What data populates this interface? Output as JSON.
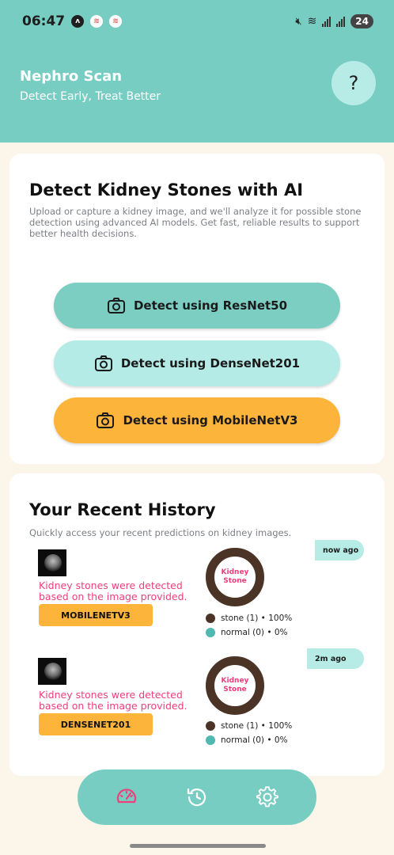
{
  "status_bar": {
    "time": "06:47",
    "battery": "24"
  },
  "header": {
    "title": "Nephro Scan",
    "subtitle": "Detect Early, Treat Better",
    "help_label": "?"
  },
  "detect_card": {
    "title": "Detect Kidney Stones with AI",
    "description": "Upload or capture a kidney image, and we'll analyze it for possible stone detection using advanced AI models. Get fast, reliable results to support better health decisions.",
    "buttons": [
      {
        "label": "Detect using ResNet50",
        "icon": "camera-icon",
        "color": "#7ccec3"
      },
      {
        "label": "Detect using DenseNet201",
        "icon": "camera-icon",
        "color": "#b5ebe6"
      },
      {
        "label": "Detect using MobileNetV3",
        "icon": "camera-icon",
        "color": "#fdb43a"
      }
    ]
  },
  "history_card": {
    "title": "Your Recent History",
    "description": "Quickly access your recent predictions on kidney images.",
    "items": [
      {
        "time": "now ago",
        "result": "Kidney stones were detected based on the image provided.",
        "model": "MOBILENETV3",
        "donut_label_line1": "Kidney",
        "donut_label_line2": "Stone",
        "legend_stone": "stone (1) • 100%",
        "legend_normal": "normal (0) • 0%",
        "stone_fraction": 1.0
      },
      {
        "time": "2m ago",
        "result": "Kidney stones were detected based on the image provided.",
        "model": "DENSENET201",
        "donut_label_line1": "Kidney",
        "donut_label_line2": "Stone",
        "legend_stone": "stone (1) • 100%",
        "legend_normal": "normal (0) • 0%",
        "stone_fraction": 1.0
      }
    ]
  },
  "bottom_nav": {
    "items": [
      "dashboard-icon",
      "history-icon",
      "settings-icon"
    ],
    "active": "dashboard-icon"
  },
  "colors": {
    "primary": "#78cdc3",
    "light_teal": "#b5ebe6",
    "orange": "#fdb43a",
    "pink": "#ee3f7b",
    "stone_brown": "#4b3426",
    "normal_teal": "#4fb8b0"
  }
}
